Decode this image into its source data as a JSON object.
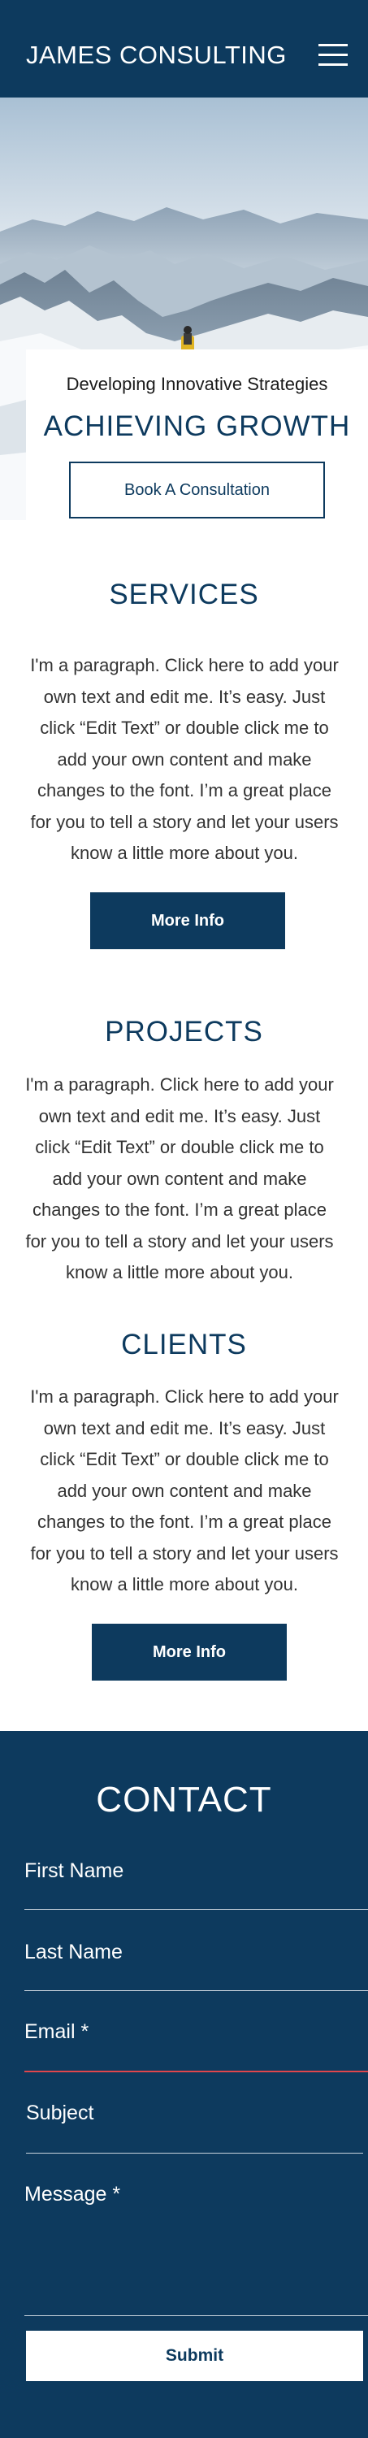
{
  "header": {
    "brand": "JAMES CONSULTING",
    "menu_icon": "hamburger-menu-icon"
  },
  "hero": {
    "image_icon": "mountain-climber-photo",
    "tagline": "Developing Innovative Strategies",
    "heading": "ACHIEVING GROWTH",
    "cta_label": "Book A Consultation"
  },
  "services": {
    "title": "SERVICES",
    "lines": [
      "I'm a paragraph. Click here to add your",
      "own text and edit me. It’s easy. Just",
      "click “Edit Text” or double click me to",
      "add your own content and make",
      "changes to the font. I’m a great place",
      "for you to tell a story and let your users",
      "know a little more about you."
    ],
    "button_label": "More Info"
  },
  "projects": {
    "title": "PROJECTS",
    "lines": [
      "I'm a paragraph. Click here to add your",
      "own text and edit me. It’s easy. Just",
      "click “Edit Text” or double click me to",
      "add your own content and make",
      "changes to the font. I’m a great place",
      "for you to tell a story and let your users",
      "know a little more about you."
    ]
  },
  "clients": {
    "title": "CLIENTS",
    "lines": [
      "I'm a paragraph. Click here to add your",
      "own text and edit me. It’s easy. Just",
      "click “Edit Text” or double click me to",
      "add your own content and make",
      "changes to the font. I’m a great place",
      "for you to tell a story and let your users",
      "know a little more about you."
    ],
    "button_label": "More Info"
  },
  "contact": {
    "title": "CONTACT",
    "fields": {
      "first_name": "First Name",
      "last_name": "Last Name",
      "email": "Email *",
      "subject": "Subject",
      "message": "Message *"
    },
    "submit_label": "Submit",
    "error_color": "#e0464c"
  },
  "colors": {
    "brand_navy": "#0d3a5e",
    "text": "#333333",
    "background": "#ffffff"
  }
}
